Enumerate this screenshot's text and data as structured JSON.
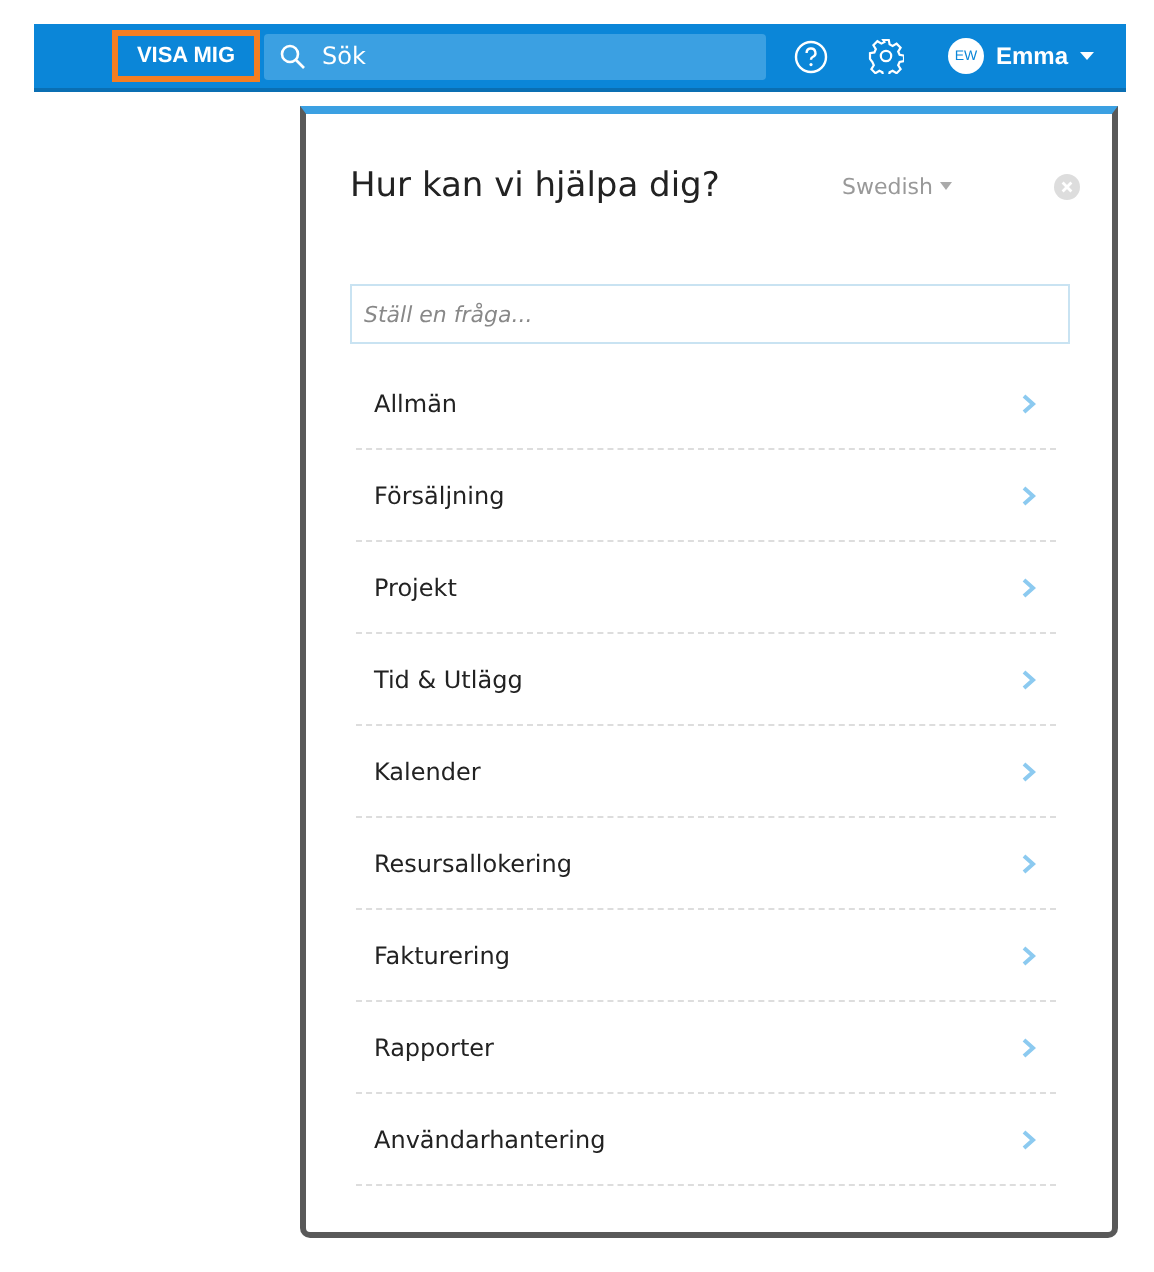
{
  "header": {
    "highlight_button": "VISA MIG",
    "search": {
      "value": "Sök"
    },
    "user": {
      "initials": "EW",
      "name": "Emma"
    }
  },
  "help_panel": {
    "title": "Hur kan vi hjälpa dig?",
    "language": "Swedish",
    "question_field": {
      "placeholder": "Ställ en fråga..."
    },
    "topics": [
      {
        "label": "Allmän"
      },
      {
        "label": "Försäljning"
      },
      {
        "label": "Projekt"
      },
      {
        "label": "Tid & Utlägg"
      },
      {
        "label": "Kalender"
      },
      {
        "label": "Resursallokering"
      },
      {
        "label": "Fakturering"
      },
      {
        "label": "Rapporter"
      },
      {
        "label": "Användarhantering"
      }
    ]
  }
}
